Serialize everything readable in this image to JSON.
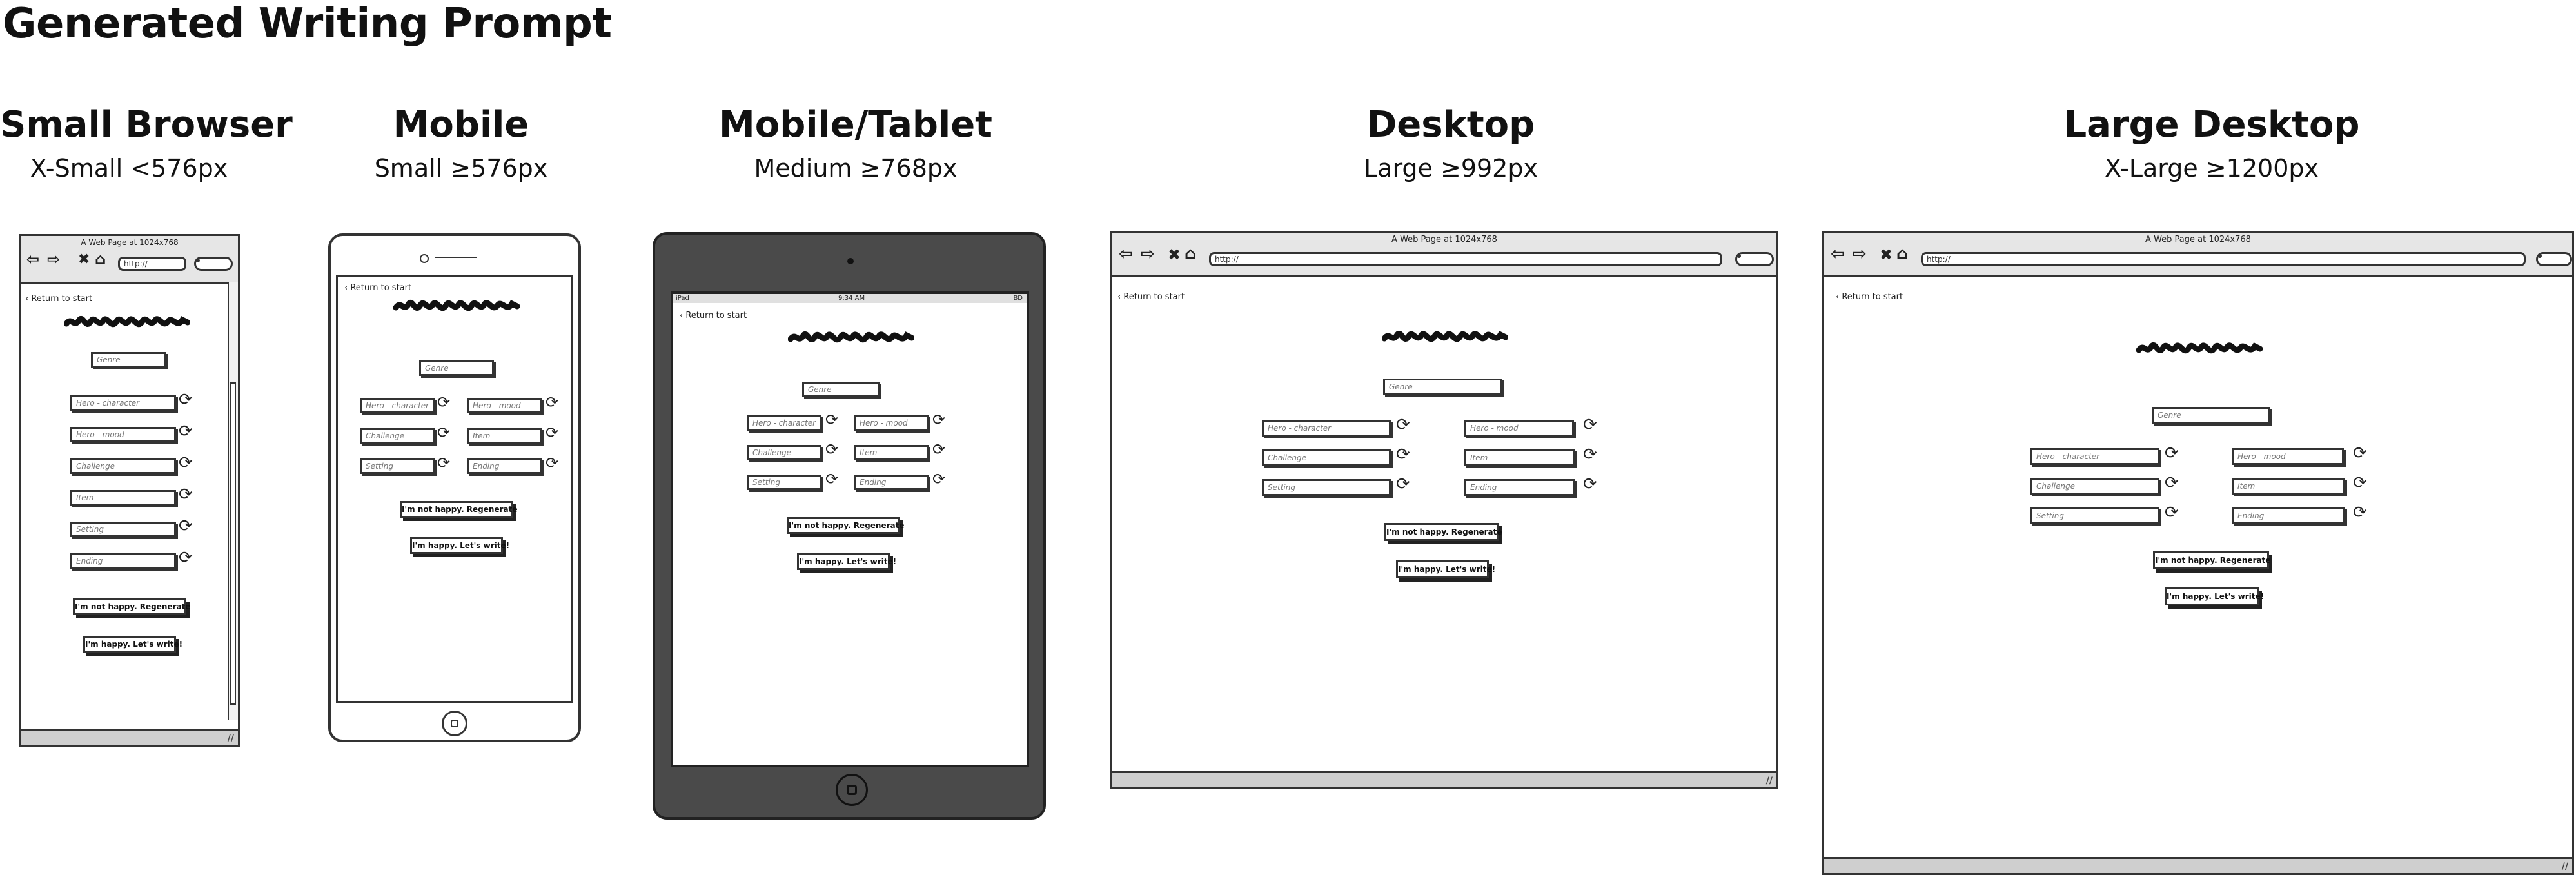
{
  "page_title": "Generated Writing Prompt",
  "columns": [
    {
      "title": "Small Browser",
      "subtitle": "X-Small   <576px"
    },
    {
      "title": "Mobile",
      "subtitle": "Small   ≥576px"
    },
    {
      "title": "Mobile/Tablet",
      "subtitle": "Medium   ≥768px"
    },
    {
      "title": "Desktop",
      "subtitle": "Large   ≥992px"
    },
    {
      "title": "Large Desktop",
      "subtitle": "X-Large   ≥1200px"
    }
  ],
  "browser": {
    "window_title": "A Web Page at 1024x768",
    "url": "http://",
    "back_icon": "arrow-left-icon",
    "forward_icon": "arrow-right-icon",
    "stop_icon": "close-icon",
    "home_icon": "home-icon",
    "search_icon": "search-icon",
    "resize_icon": "resize-grip-icon"
  },
  "tablet_status": {
    "device": "iPad",
    "time": "9:34 AM",
    "battery": "BD"
  },
  "app": {
    "back_link": "Return to start",
    "genre_placeholder": "Genre",
    "fields": {
      "hero_character": "Hero - character",
      "hero_mood": "Hero - mood",
      "challenge": "Challenge",
      "item": "Item",
      "setting": "Setting",
      "ending": "Ending"
    },
    "refresh_icon": "refresh-icon",
    "regenerate_button": "I'm not happy. Regenerate",
    "write_button": "I'm happy. Let's write!"
  }
}
